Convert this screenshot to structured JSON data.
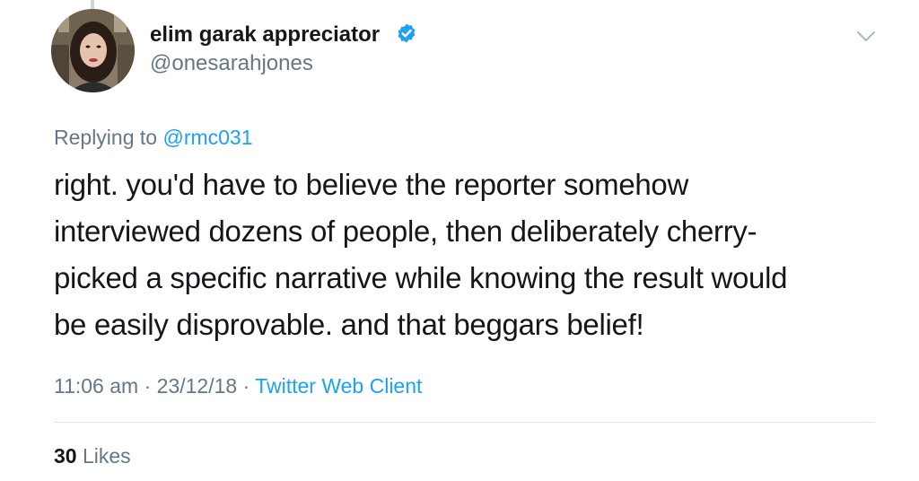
{
  "author": {
    "display_name": "elim garak appreciator",
    "handle": "@onesarahjones",
    "verified": true,
    "avatar_icon": "profile-photo"
  },
  "reply": {
    "prefix": "Replying to ",
    "mention": "@rmc031"
  },
  "body": {
    "lines": [
      "right. you'd have to believe the reporter somehow",
      "interviewed dozens of people, then deliberately cherry-",
      "picked a specific narrative while knowing the result would",
      "be easily disprovable. and that beggars belief!"
    ]
  },
  "meta": {
    "time": "11:06 am",
    "separator": " · ",
    "date": "23/12/18",
    "client": "Twitter Web Client"
  },
  "stats": {
    "likes_count": "30",
    "likes_label": "Likes"
  },
  "colors": {
    "link": "#1da1f2",
    "muted": "#657786",
    "text": "#14171a",
    "divider": "#e1e8ed"
  }
}
